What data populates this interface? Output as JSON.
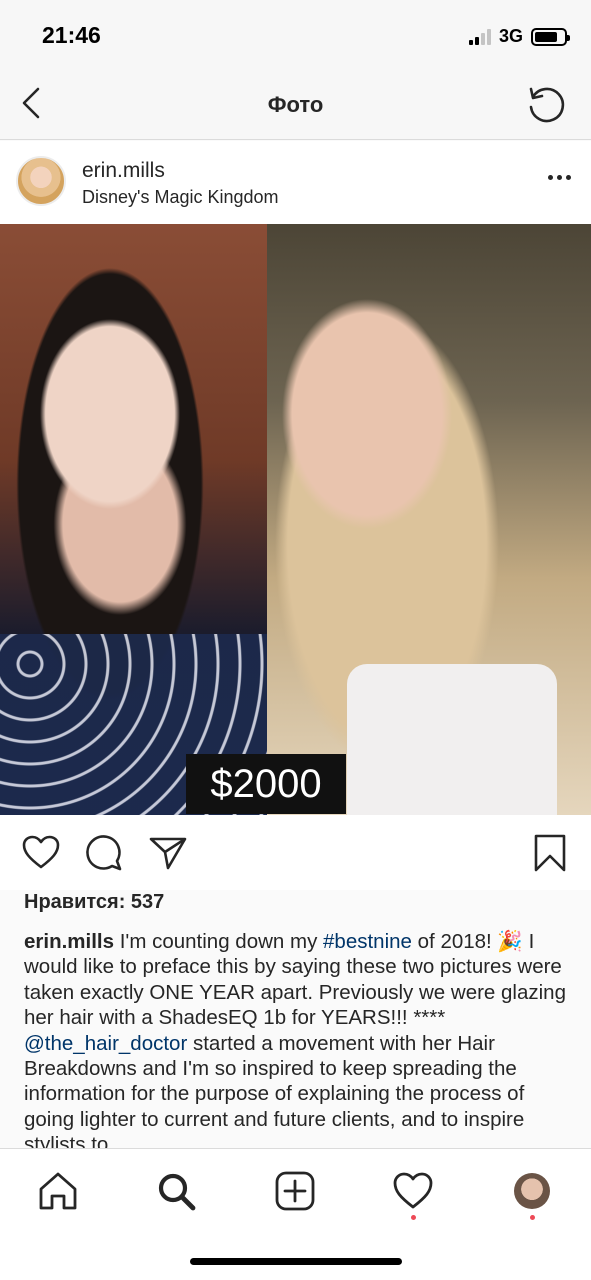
{
  "status_bar": {
    "time": "21:46",
    "network": "3G",
    "battery_level": 0.8
  },
  "nav": {
    "title": "Фото",
    "back_icon": "chevron-left-icon",
    "refresh_icon": "refresh-icon"
  },
  "post": {
    "username": "erin.mills",
    "location": "Disney's Magic Kingdom",
    "price_overlay": "$2000",
    "likes_text": "Нравится: 537",
    "caption": {
      "username": "erin.mills",
      "part1": " I'm counting down my ",
      "hashtag": "#bestnine",
      "part2": " of 2018! 🎉 I would like to preface this by saying these two pictures were taken exactly ONE YEAR apart. Previously we were glazing her hair with a ShadesEQ 1b for YEARS!!! **** ",
      "mention": "@the_hair_doctor",
      "part3": " started a movement with her Hair Breakdowns and I'm so inspired to keep spreading the information for the purpose of explaining the process of going lighter to current and future clients, and to inspire stylists to"
    }
  },
  "actions": [
    "heart-icon",
    "comment-icon",
    "share-icon",
    "bookmark-icon"
  ],
  "tab_bar": [
    "home-icon",
    "search-icon",
    "add-icon",
    "activity-icon",
    "profile-avatar"
  ]
}
